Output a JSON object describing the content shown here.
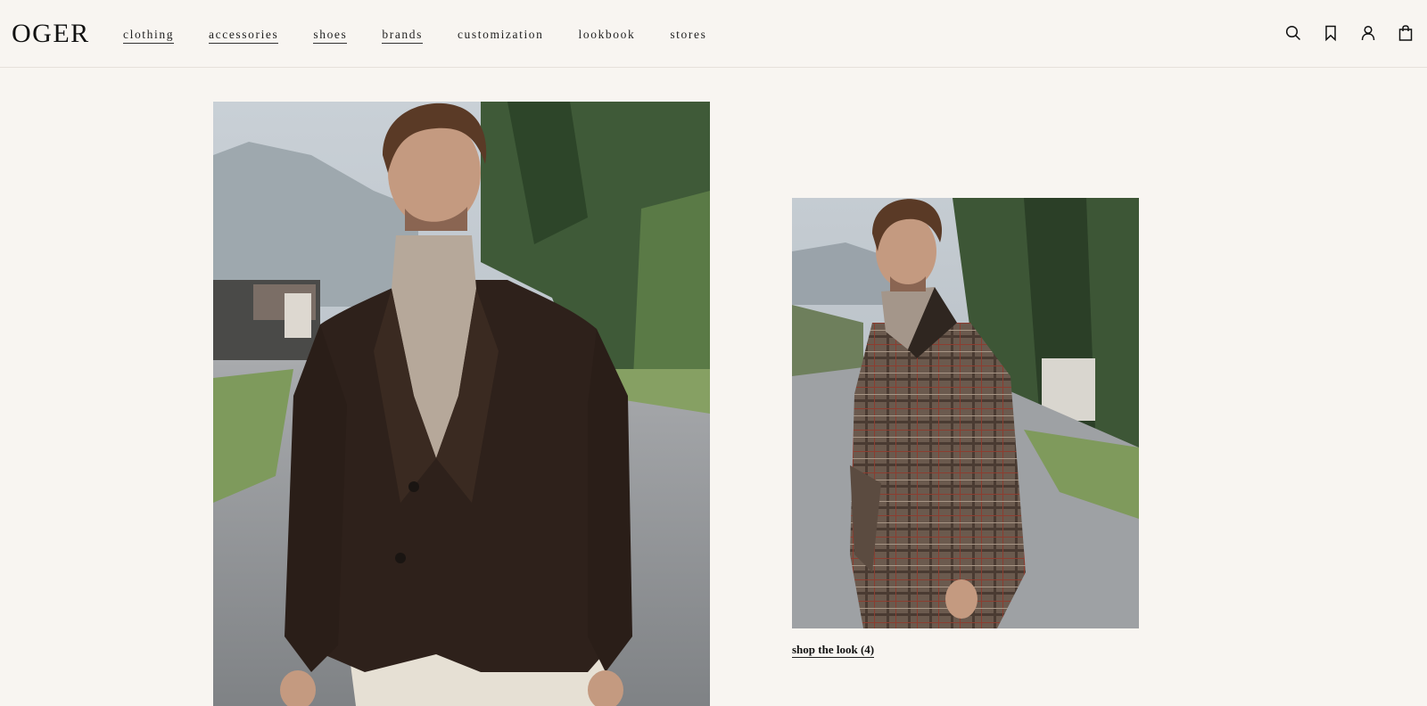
{
  "brand": {
    "logo_text": "OGER"
  },
  "nav": {
    "items": [
      {
        "label": "clothing"
      },
      {
        "label": "accessories"
      },
      {
        "label": "shoes"
      },
      {
        "label": "brands"
      },
      {
        "label": "customization"
      },
      {
        "label": "lookbook"
      },
      {
        "label": "stores"
      }
    ]
  },
  "header_icons": [
    "search-icon",
    "bookmark-icon",
    "account-icon",
    "shopping-bag-icon"
  ],
  "lookbook": {
    "main_image": {
      "subject": "man-in-brown-knit-blazer-and-turtleneck"
    },
    "second_image": {
      "subject": "man-in-checked-overcoat"
    },
    "shop_link": "shop the look (4)"
  },
  "colors": {
    "background": "#f8f5f1",
    "text": "#1a1a1a",
    "divider": "#e6e1da"
  }
}
